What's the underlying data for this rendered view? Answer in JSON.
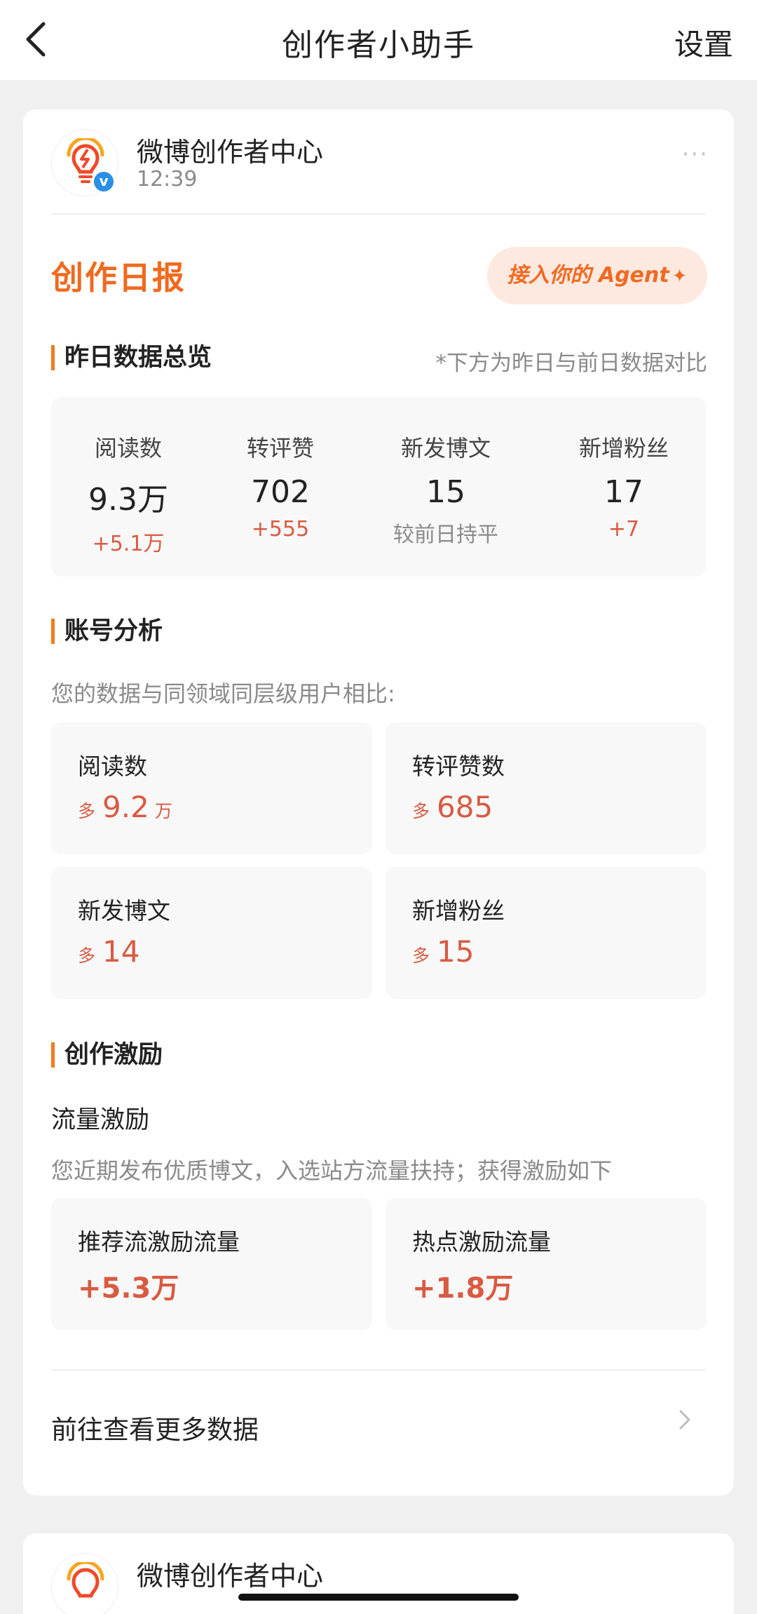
{
  "header": {
    "title": "创作者小助手",
    "settings_label": "设置"
  },
  "post": {
    "account_name": "微博创作者中心",
    "time": "12:39",
    "more_label": "···",
    "daily_title": "创作日报",
    "agent_button": "接入你的 Agent",
    "overview": {
      "title": "昨日数据总览",
      "note": "*下方为昨日与前日数据对比",
      "stats": [
        {
          "label": "阅读数",
          "value": "9.3万",
          "delta": "+5.1万"
        },
        {
          "label": "转评赞",
          "value": "702",
          "delta": "+555"
        },
        {
          "label": "新发博文",
          "value": "15",
          "delta": "较前日持平"
        },
        {
          "label": "新增粉丝",
          "value": "17",
          "delta": "+7"
        }
      ]
    },
    "analysis": {
      "title": "账号分析",
      "note": "您的数据与同领域同层级用户相比:",
      "items": [
        {
          "label": "阅读数",
          "prefix": "多",
          "value": "9.2",
          "unit": "万"
        },
        {
          "label": "转评赞数",
          "prefix": "多",
          "value": "685",
          "unit": ""
        },
        {
          "label": "新发博文",
          "prefix": "多",
          "value": "14",
          "unit": ""
        },
        {
          "label": "新增粉丝",
          "prefix": "多",
          "value": "15",
          "unit": ""
        }
      ]
    },
    "incentive": {
      "title": "创作激励",
      "subtitle": "流量激励",
      "note": "您近期发布优质博文，入选站方流量扶持；获得激励如下",
      "items": [
        {
          "label": "推荐流激励流量",
          "value": "+5.3万"
        },
        {
          "label": "热点激励流量",
          "value": "+1.8万"
        }
      ]
    },
    "more_data_link": "前往查看更多数据"
  },
  "next_post": {
    "account_name": "微博创作者中心"
  },
  "colors": {
    "accent": "#f06a1e",
    "positive": "#d85b42",
    "verified": "#2a8fe5"
  }
}
